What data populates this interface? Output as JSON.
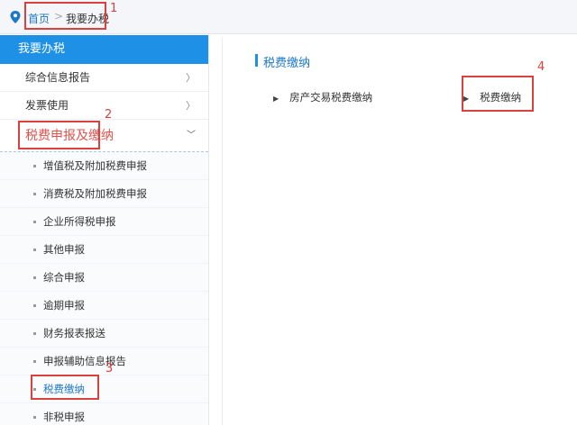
{
  "breadcrumb": {
    "home": "首页",
    "separator": ">",
    "current": "我要办税"
  },
  "sidebar": {
    "header": "我要办税",
    "menu": [
      {
        "label": "综合信息报告",
        "arrow": "〉"
      },
      {
        "label": "发票使用",
        "arrow": "〉"
      },
      {
        "label": "税费申报及缴纳",
        "arrow": "﹀"
      }
    ],
    "sub_items": [
      {
        "label": "增值税及附加税费申报"
      },
      {
        "label": "消费税及附加税费申报"
      },
      {
        "label": "企业所得税申报"
      },
      {
        "label": "其他申报"
      },
      {
        "label": "综合申报"
      },
      {
        "label": "逾期申报"
      },
      {
        "label": "财务报表报送"
      },
      {
        "label": "申报辅助信息报告"
      },
      {
        "label": "税费缴纳"
      },
      {
        "label": "非税申报"
      }
    ]
  },
  "main": {
    "section_title": "税费缴纳",
    "links": [
      {
        "label": "房产交易税费缴纳"
      },
      {
        "label": "税费缴纳"
      }
    ]
  },
  "annotations": [
    "1",
    "2",
    "3",
    "4"
  ],
  "colors": {
    "accent": "#1e90e6",
    "annotation": "#d9413c",
    "open_menu": "#e0524b"
  }
}
